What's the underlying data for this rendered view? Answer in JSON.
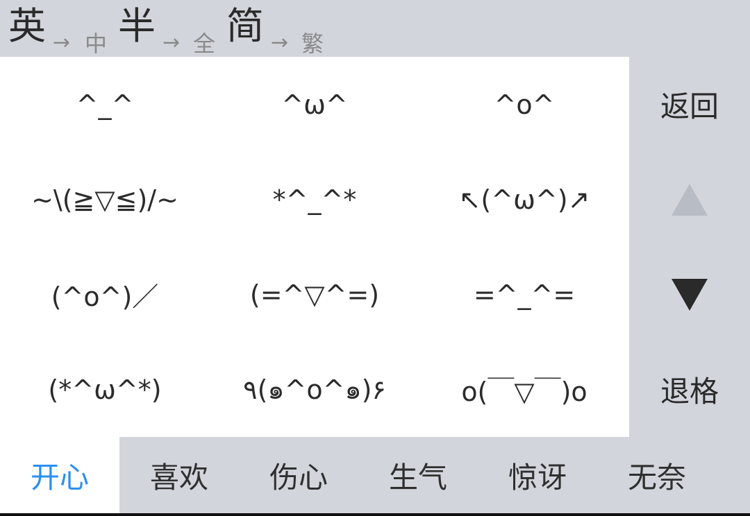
{
  "mode_bar": {
    "items": [
      {
        "big": "英",
        "arrow": "→",
        "small": "中"
      },
      {
        "big": "半",
        "arrow": "→",
        "small": "全"
      },
      {
        "big": "简",
        "arrow": "→",
        "small": "繁"
      }
    ]
  },
  "emoticons": [
    "^_^",
    "^ω^",
    "^o^",
    "~\\(≧▽≦)/~",
    "*^_^*",
    "↖(^ω^)↗",
    "(^o^)／",
    "(=^▽^=)",
    "=^_^=",
    "(*^ω^*)",
    "٩(๑^o^๑)۶",
    "o(￣▽￣)o"
  ],
  "side": {
    "back_label": "返回",
    "backspace_label": "退格",
    "up_icon": "triangle-up-icon",
    "down_icon": "triangle-down-icon"
  },
  "tabs": {
    "items": [
      "开心",
      "喜欢",
      "伤心",
      "生气",
      "惊讶",
      "无奈"
    ],
    "active_color": "#2b8ff0"
  },
  "colors": {
    "background": "#d3d5dc",
    "panel": "#ffffff",
    "text": "#2a2a2a",
    "muted": "#8a8a8a",
    "disabled": "#b8bcc4"
  }
}
